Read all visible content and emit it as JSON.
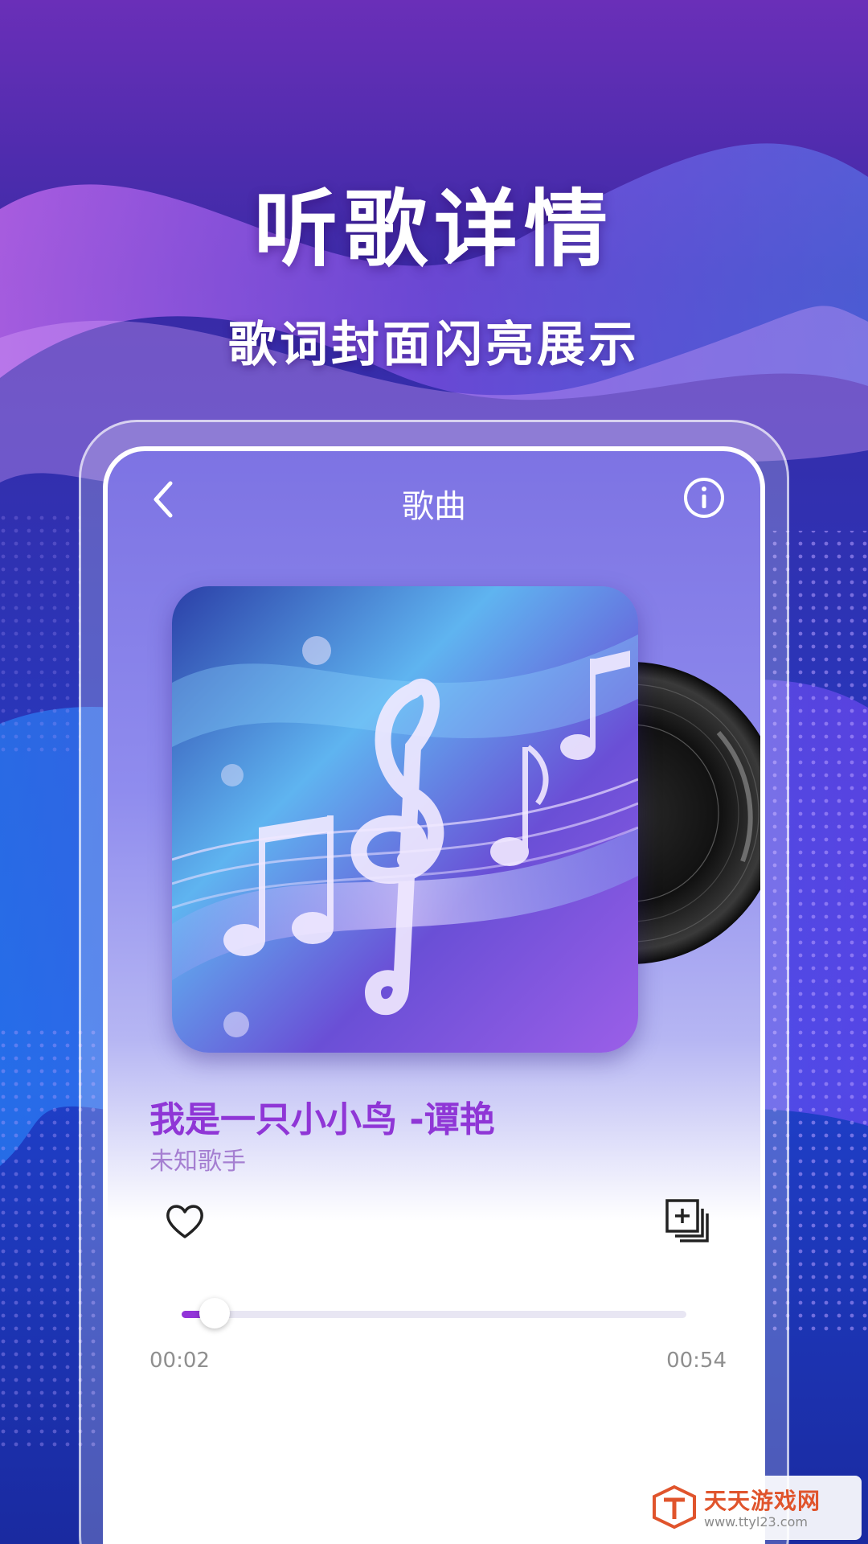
{
  "promo": {
    "headline": "听歌详情",
    "subheadline": "歌词封面闪亮展示"
  },
  "screen": {
    "title": "歌曲",
    "back_icon": "chevron-left-icon",
    "info_icon": "info-circle-icon"
  },
  "song": {
    "title": "我是一只小小鸟 -谭艳",
    "artist": "未知歌手"
  },
  "actions": {
    "favorite_icon": "heart-outline-icon",
    "add_to_playlist_icon": "playlist-add-icon"
  },
  "playback": {
    "current_time": "00:02",
    "total_time": "00:54",
    "progress": 0.065
  },
  "watermark": {
    "name": "天天游戏网",
    "url": "www.ttyl23.com"
  },
  "colors": {
    "accent": "#9234d8",
    "song_title": "#8f36d6",
    "artist": "#a57fd1"
  }
}
